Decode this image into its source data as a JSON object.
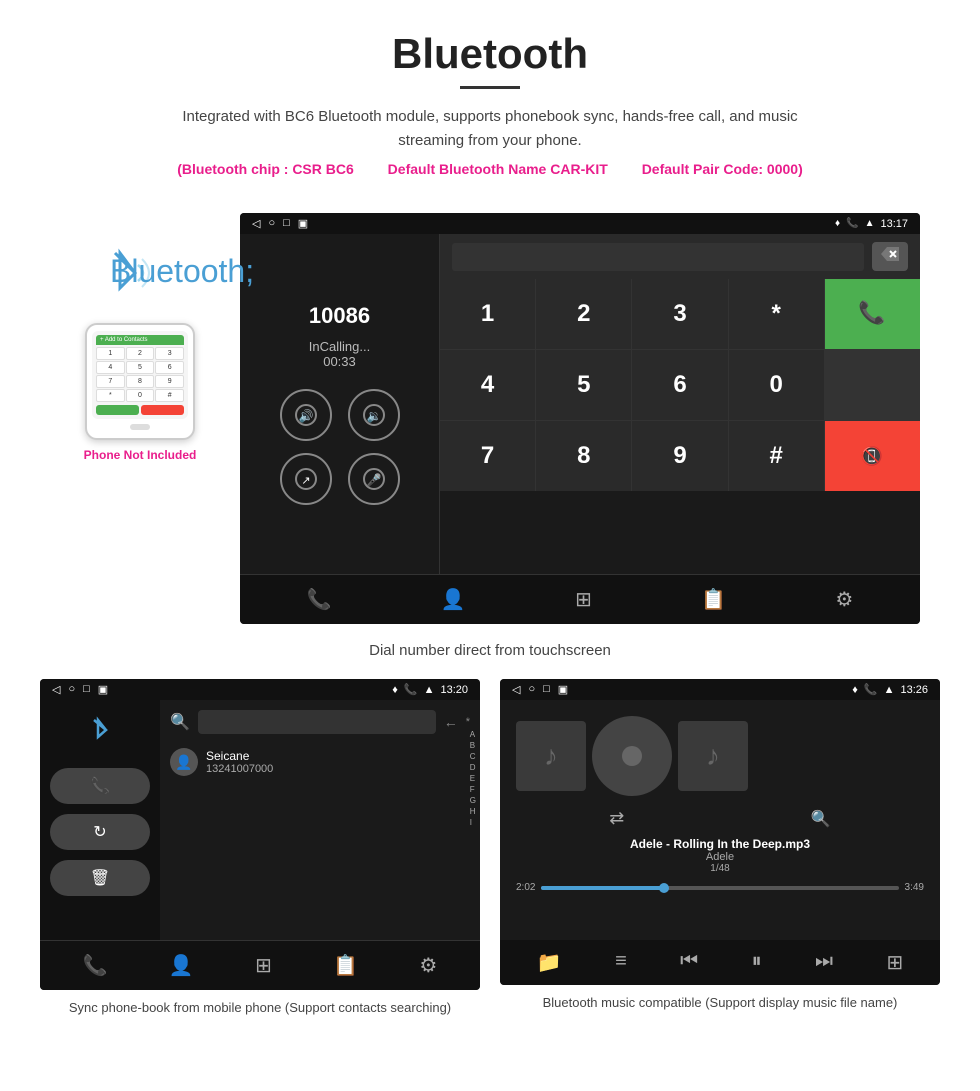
{
  "header": {
    "title": "Bluetooth",
    "description": "Integrated with BC6 Bluetooth module, supports phonebook sync, hands-free call, and music streaming from your phone.",
    "spec1": "(Bluetooth chip : CSR BC6",
    "spec2": "Default Bluetooth Name CAR-KIT",
    "spec3": "Default Pair Code: 0000)"
  },
  "phone_label": "Phone Not Included",
  "main_screen": {
    "status_time": "13:17",
    "caller_number": "10086",
    "call_status": "InCalling...",
    "call_timer": "00:33",
    "keys": [
      "1",
      "2",
      "3",
      "*",
      "4",
      "5",
      "6",
      "0",
      "7",
      "8",
      "9",
      "#"
    ]
  },
  "main_caption": "Dial number direct from touchscreen",
  "phonebook_screen": {
    "status_time": "13:20",
    "contact_name": "Seicane",
    "contact_number": "13241007000",
    "alpha_letters": [
      "A",
      "B",
      "C",
      "D",
      "E",
      "F",
      "G",
      "H",
      "I"
    ]
  },
  "music_screen": {
    "status_time": "13:26",
    "song_title": "Adele - Rolling In the Deep.mp3",
    "artist": "Adele",
    "fraction": "1/48",
    "time_current": "2:02",
    "time_total": "3:49"
  },
  "bottom_caption_left": "Sync phone-book from mobile phone\n(Support contacts searching)",
  "bottom_caption_right": "Bluetooth music compatible\n(Support display music file name)",
  "icons": {
    "bluetooth": "✦",
    "phone": "📞",
    "volume_up": "🔊",
    "volume_down": "🔉",
    "mute": "🔇",
    "mic": "🎤",
    "transfer": "↗",
    "search": "🔍",
    "music_note": "♪",
    "shuffle": "⇄",
    "prev": "⏮",
    "play": "⏸",
    "next": "⏭",
    "eq": "⊞"
  }
}
